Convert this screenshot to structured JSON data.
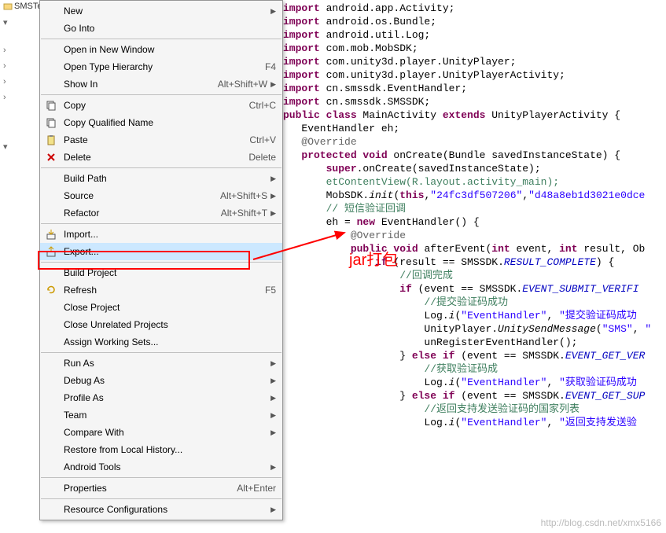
{
  "project_name": "SMSTest",
  "annotation_label": "jar打包",
  "menu_items": [
    {
      "icon": "",
      "label": "New",
      "key": "",
      "arrow": true
    },
    {
      "icon": "",
      "label": "Go Into",
      "key": "",
      "arrow": false
    },
    {
      "sep": true
    },
    {
      "icon": "",
      "label": "Open in New Window",
      "key": "",
      "arrow": false
    },
    {
      "icon": "",
      "label": "Open Type Hierarchy",
      "key": "F4",
      "arrow": false
    },
    {
      "icon": "",
      "label": "Show In",
      "key": "Alt+Shift+W",
      "arrow": true
    },
    {
      "sep": true
    },
    {
      "icon": "copy",
      "label": "Copy",
      "key": "Ctrl+C",
      "arrow": false
    },
    {
      "icon": "copyq",
      "label": "Copy Qualified Name",
      "key": "",
      "arrow": false
    },
    {
      "icon": "paste",
      "label": "Paste",
      "key": "Ctrl+V",
      "arrow": false
    },
    {
      "icon": "delete",
      "label": "Delete",
      "key": "Delete",
      "arrow": false
    },
    {
      "sep": true
    },
    {
      "icon": "",
      "label": "Build Path",
      "key": "",
      "arrow": true
    },
    {
      "icon": "",
      "label": "Source",
      "key": "Alt+Shift+S",
      "arrow": true
    },
    {
      "icon": "",
      "label": "Refactor",
      "key": "Alt+Shift+T",
      "arrow": true
    },
    {
      "sep": true
    },
    {
      "icon": "import",
      "label": "Import...",
      "key": "",
      "arrow": false
    },
    {
      "icon": "export",
      "label": "Export...",
      "key": "",
      "arrow": false,
      "highlight": true
    },
    {
      "sep": true
    },
    {
      "icon": "",
      "label": "Build Project",
      "key": "",
      "arrow": false
    },
    {
      "icon": "refresh",
      "label": "Refresh",
      "key": "F5",
      "arrow": false
    },
    {
      "icon": "",
      "label": "Close Project",
      "key": "",
      "arrow": false
    },
    {
      "icon": "",
      "label": "Close Unrelated Projects",
      "key": "",
      "arrow": false
    },
    {
      "icon": "",
      "label": "Assign Working Sets...",
      "key": "",
      "arrow": false
    },
    {
      "sep": true
    },
    {
      "icon": "",
      "label": "Run As",
      "key": "",
      "arrow": true
    },
    {
      "icon": "",
      "label": "Debug As",
      "key": "",
      "arrow": true
    },
    {
      "icon": "",
      "label": "Profile As",
      "key": "",
      "arrow": true
    },
    {
      "icon": "",
      "label": "Team",
      "key": "",
      "arrow": true
    },
    {
      "icon": "",
      "label": "Compare With",
      "key": "",
      "arrow": true
    },
    {
      "icon": "",
      "label": "Restore from Local History...",
      "key": "",
      "arrow": false
    },
    {
      "icon": "",
      "label": "Android Tools",
      "key": "",
      "arrow": true
    },
    {
      "sep": true
    },
    {
      "icon": "",
      "label": "Properties",
      "key": "Alt+Enter",
      "arrow": false
    },
    {
      "sep": true
    },
    {
      "icon": "",
      "label": "Resource Configurations",
      "key": "",
      "arrow": true
    }
  ],
  "code_lines": [
    "<span class='kw'>import</span> android.app.Activity;",
    "<span class='kw'>import</span> android.os.Bundle;",
    "<span class='kw'>import</span> android.util.Log;",
    "",
    "<span class='kw'>import</span> com.mob.MobSDK;",
    "<span class='kw'>import</span> com.unity3d.player.UnityPlayer;",
    "<span class='kw'>import</span> com.unity3d.player.UnityPlayerActivity;",
    "<span class='kw'>import</span> cn.smssdk.EventHandler;",
    "<span class='kw'>import</span> cn.smssdk.SMSSDK;",
    "",
    "<span class='kw'>public class</span> MainActivity <span class='kw'>extends</span> UnityPlayerActivity {",
    "",
    "   EventHandler eh;",
    "",
    "   <span class='ann'>@Override</span>",
    "   <span class='kw'>protected void</span> onCreate(Bundle savedInstanceState) {",
    "       <span class='kw'>super</span>.onCreate(savedInstanceState);",
    "       <span class='todo'>etContentView(R.layout.activity_main);</span>",
    "",
    "       MobSDK.<span style='font-style:italic'>init</span>(<span class='kw'>this</span>,<span class='str'>\"24fc3df507206\"</span>,<span class='str'>\"d48a8eb1d3021e0dce</span>",
    "",
    "       <span class='cmt'>// 短信验证回调</span>",
    "       eh = <span class='kw'>new</span> EventHandler() {",
    "           <span class='ann'>@Override</span>",
    "           <span class='kw'>public void</span> afterEvent(<span class='kw'>int</span> event, <span class='kw'>int</span> result, Ob",
    "               <span class='kw'>if</span> (result == SMSSDK.<span class='sconst'>RESULT_COMPLETE</span>) {",
    "                   <span class='cmt'>//回调完成</span>",
    "                   <span class='kw'>if</span> (event == SMSSDK.<span class='sconst'>EVENT_SUBMIT_VERIFI</span>",
    "                       <span class='cmt'>//提交验证码成功</span>",
    "                       Log.<span style='font-style:italic'>i</span>(<span class='str'>\"EventHandler\"</span>, <span class='str'>\"提交验证码成功</span>",
    "                       UnityPlayer.<span style='font-style:italic'>UnitySendMessage</span>(<span class='str'>\"SMS\"</span>, <span class='str'>\"</span>",
    "                       unRegisterEventHandler();",
    "                   } <span class='kw'>else if</span> (event == SMSSDK.<span class='sconst'>EVENT_GET_VER</span>",
    "                       <span class='cmt'>//获取验证码成</span>",
    "                       Log.<span style='font-style:italic'>i</span>(<span class='str'>\"EventHandler\"</span>, <span class='str'>\"获取验证码成功</span>",
    "                   } <span class='kw'>else if</span> (event == SMSSDK.<span class='sconst'>EVENT_GET_SUP</span>",
    "                       <span class='cmt'>//返回支持发送验证码的国家列表</span>",
    "                       Log.<span style='font-style:italic'>i</span>(<span class='str'>\"EventHandler\"</span>, <span class='str'>\"返回支持发送验</span>"
  ],
  "watermark": "http://blog.csdn.net/xmx5166"
}
